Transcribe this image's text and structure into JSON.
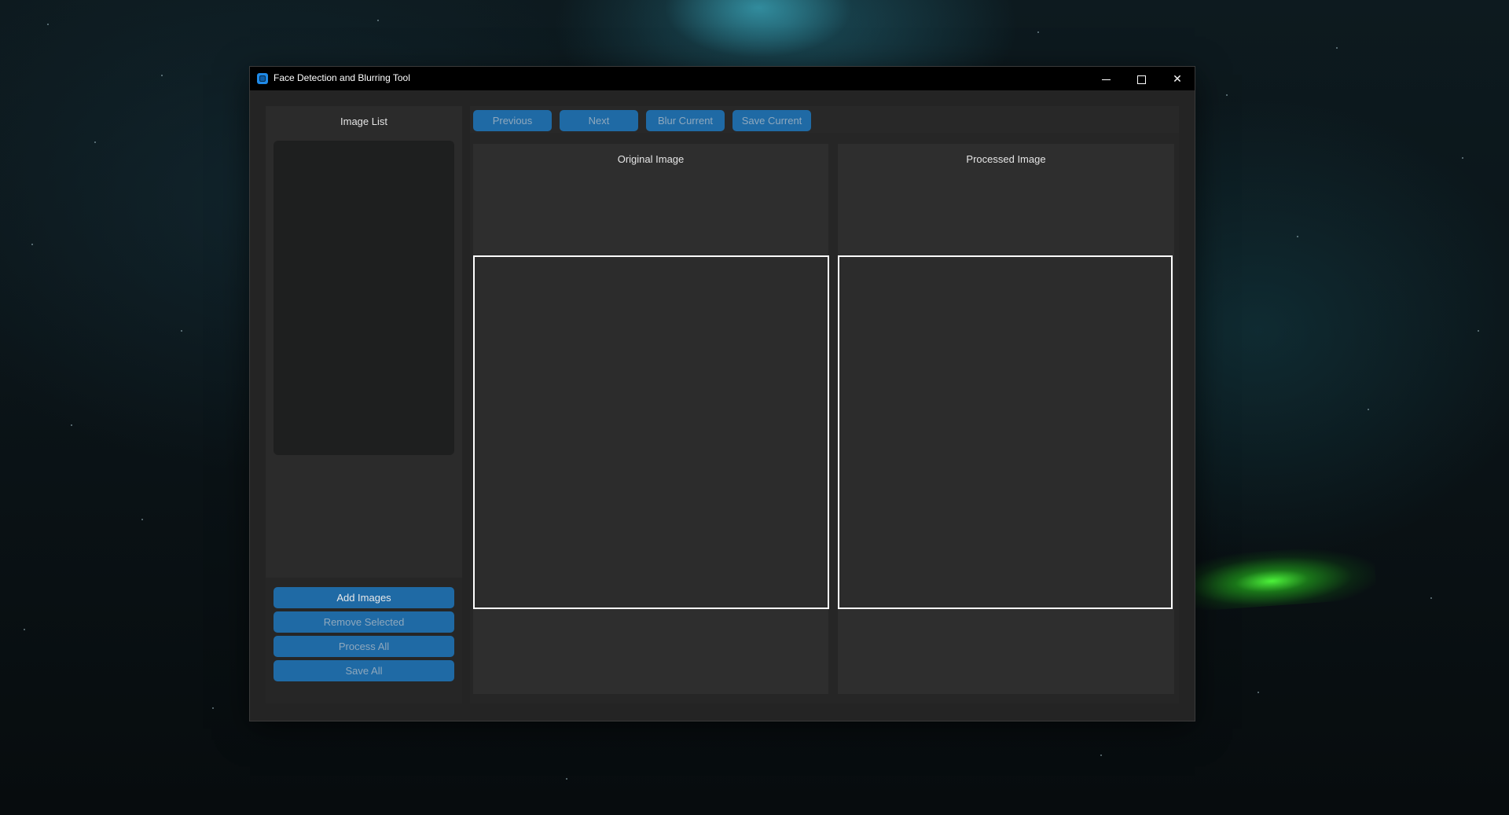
{
  "window": {
    "title": "Face Detection and Blurring Tool",
    "controls": {
      "minimize_icon": "minimize-icon",
      "maximize_icon": "maximize-icon",
      "close_icon": "close-icon",
      "close_glyph": "✕"
    }
  },
  "sidebar": {
    "title": "Image List",
    "buttons": {
      "add_images": "Add Images",
      "remove_selected": "Remove Selected",
      "process_all": "Process All",
      "save_all": "Save All"
    }
  },
  "toolbar": {
    "previous": "Previous",
    "next": "Next",
    "blur_current": "Blur Current",
    "save_current": "Save Current"
  },
  "panes": {
    "original_title": "Original Image",
    "processed_title": "Processed Image"
  },
  "colors": {
    "button": "#1f6aa5",
    "window_bg": "#242424",
    "titlebar": "#000000",
    "accent_icon": "#1f8ae8"
  }
}
